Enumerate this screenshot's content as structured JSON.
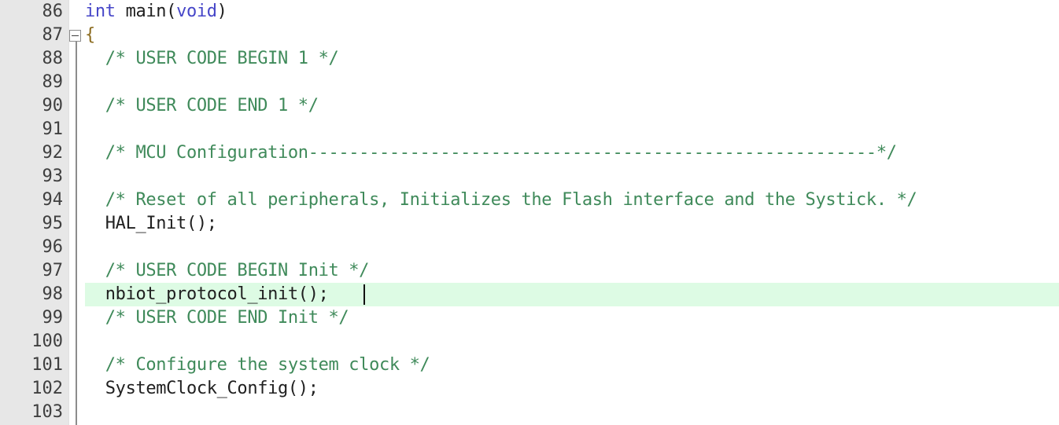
{
  "editor": {
    "first_line_number": 86,
    "line_count": 18,
    "highlighted_line_number": 98,
    "fold_marker_line_number": 87,
    "colors": {
      "gutter_background": "#e7e7e7",
      "editor_background": "#ffffff",
      "current_line_highlight": "#ddfbe4",
      "comment": "#3f8a5a",
      "keyword": "#4646c8",
      "plain_text": "#202020",
      "bracket": "#8b6b1f",
      "caret": "#111111",
      "fold_line": "#8c8c8c"
    },
    "fold_marker": {
      "name": "collapse-fold-marker",
      "glyph": "minus"
    },
    "lines": [
      {
        "number": "86",
        "highlighted": false,
        "tokens": [
          {
            "text": "int",
            "type": "kw"
          },
          {
            "text": " main(",
            "type": "plain"
          },
          {
            "text": "void",
            "type": "kw"
          },
          {
            "text": ")",
            "type": "plain"
          }
        ]
      },
      {
        "number": "87",
        "highlighted": false,
        "tokens": [
          {
            "text": "{",
            "type": "brace"
          }
        ]
      },
      {
        "number": "88",
        "highlighted": false,
        "tokens": [
          {
            "text": "  /* USER CODE BEGIN 1 */",
            "type": "cmt"
          }
        ]
      },
      {
        "number": "89",
        "highlighted": false,
        "tokens": []
      },
      {
        "number": "90",
        "highlighted": false,
        "tokens": [
          {
            "text": "  /* USER CODE END 1 */",
            "type": "cmt"
          }
        ]
      },
      {
        "number": "91",
        "highlighted": false,
        "tokens": []
      },
      {
        "number": "92",
        "highlighted": false,
        "tokens": [
          {
            "text": "  /* MCU Configuration--------------------------------------------------------*/",
            "type": "cmt"
          }
        ]
      },
      {
        "number": "93",
        "highlighted": false,
        "tokens": []
      },
      {
        "number": "94",
        "highlighted": false,
        "tokens": [
          {
            "text": "  /* Reset of all peripherals, Initializes the Flash interface and the Systick. */",
            "type": "cmt"
          }
        ]
      },
      {
        "number": "95",
        "highlighted": false,
        "tokens": [
          {
            "text": "  HAL_Init();",
            "type": "plain"
          }
        ]
      },
      {
        "number": "96",
        "highlighted": false,
        "tokens": []
      },
      {
        "number": "97",
        "highlighted": false,
        "tokens": [
          {
            "text": "  /* USER CODE BEGIN Init */",
            "type": "cmt"
          }
        ]
      },
      {
        "number": "98",
        "highlighted": true,
        "tokens": [
          {
            "text": "  nbiot_protocol_init();",
            "type": "plain"
          }
        ]
      },
      {
        "number": "99",
        "highlighted": false,
        "tokens": [
          {
            "text": "  /* USER CODE END Init */",
            "type": "cmt"
          }
        ]
      },
      {
        "number": "100",
        "highlighted": false,
        "tokens": []
      },
      {
        "number": "101",
        "highlighted": false,
        "tokens": [
          {
            "text": "  /* Configure the system clock */",
            "type": "cmt"
          }
        ]
      },
      {
        "number": "102",
        "highlighted": false,
        "tokens": [
          {
            "text": "  SystemClock_Config();",
            "type": "plain"
          }
        ]
      },
      {
        "number": "103",
        "highlighted": false,
        "tokens": []
      }
    ]
  }
}
